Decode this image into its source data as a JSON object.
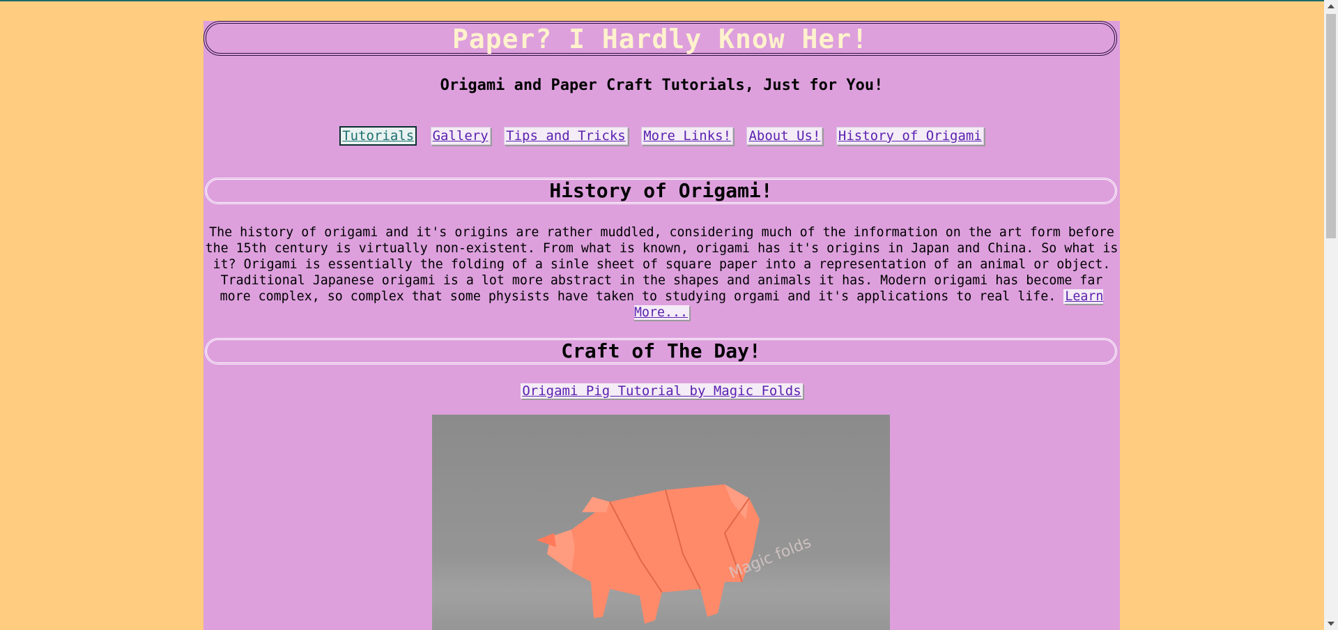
{
  "header": {
    "title": "Paper? I Hardly Know Her!",
    "tagline": "Origami and Paper Craft Tutorials, Just for You!"
  },
  "nav": {
    "items": [
      {
        "label": "Tutorials",
        "active": true
      },
      {
        "label": "Gallery"
      },
      {
        "label": "Tips and Tricks"
      },
      {
        "label": "More Links!"
      },
      {
        "label": "About Us!"
      },
      {
        "label": "History of Origami"
      }
    ]
  },
  "history": {
    "heading": "History of Origami!",
    "body": "The history of origami and it's origins are rather muddled, considering much of the information on the art form before the 15th century is virtually non-existent. From what is known, origami has it's origins in Japan and China. So what is it? Origami is essentially the folding of a sinle sheet of square paper into a representation of an animal or object. Traditional Japanese origami is a lot more abstract in the shapes and animals it has. Modern origami has become far more complex, so complex that some physists have taken to studying orgami and it's applications to real life.",
    "learn_more": "Learn More..."
  },
  "craft": {
    "heading": "Craft of The Day!",
    "link": "Origami Pig Tutorial by Magic Folds",
    "watermark": "Magic folds"
  },
  "colors": {
    "page_background": "#ffcc80",
    "content_background": "#dda0dd",
    "title_text": "#fff2cc",
    "link": "#5a1fb0",
    "active_link": "#1c6f6f",
    "pig": "#ff8a6a"
  }
}
